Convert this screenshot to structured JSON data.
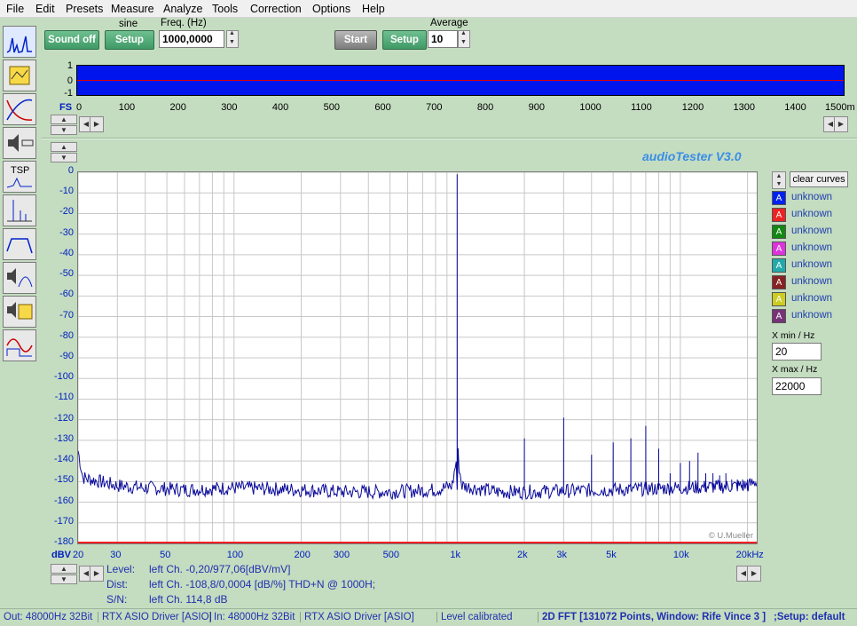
{
  "menu": [
    "File",
    "Edit",
    "Presets",
    "Measure",
    "Analyze",
    "Tools",
    "Correction",
    "Options",
    "Help"
  ],
  "generator": {
    "sound_button": "Sound off",
    "signal_type": "sine",
    "setup_button": "Setup",
    "freq_label": "Freq. (Hz)",
    "freq_value": "1000,0000"
  },
  "analyzer": {
    "start_button": "Start",
    "setup_button": "Setup",
    "average_label": "Average",
    "average_value": "10"
  },
  "scope": {
    "y_ticks": [
      "1",
      "0",
      "-1"
    ],
    "x_unit": "FS",
    "x_ticks": [
      "0",
      "100",
      "200",
      "300",
      "400",
      "500",
      "600",
      "700",
      "800",
      "900",
      "1000",
      "1100",
      "1200",
      "1300",
      "1400",
      "1500m"
    ]
  },
  "brand": "audioTester  V3.0",
  "clear_curves": "clear curves",
  "legend": [
    {
      "label": "unknown",
      "color": "#0022ee"
    },
    {
      "label": "unknown",
      "color": "#ee2222"
    },
    {
      "label": "unknown",
      "color": "#118811"
    },
    {
      "label": "unknown",
      "color": "#dd33dd"
    },
    {
      "label": "unknown",
      "color": "#22aaaa"
    },
    {
      "label": "unknown",
      "color": "#882222"
    },
    {
      "label": "unknown",
      "color": "#cccc22"
    },
    {
      "label": "unknown",
      "color": "#773377"
    }
  ],
  "x_min_label": "X min / Hz",
  "x_min_value": "20",
  "x_max_label": "X max / Hz",
  "x_max_value": "22000",
  "copyright": "© U.Mueller",
  "info": {
    "level_label": "Level:",
    "level_value": "left Ch. -0,20/977,06[dBV/mV]",
    "dist_label": "Dist:",
    "dist_value": "left Ch. -108,8/0,0004 [dB/%] THD+N  @ 1000H;",
    "sn_label": "S/N:",
    "sn_value": "left Ch. 114,8 dB"
  },
  "status": {
    "out": "Out: 48000Hz 32Bit",
    "driver_out": "RTX ASIO Driver [ASIO]",
    "in": "In: 48000Hz 32Bit",
    "driver_in": "RTX ASIO Driver [ASIO]",
    "level": "Level calibrated",
    "fft": "2D FFT [131072 Points, Window: Rife Vince 3 ]",
    "setup": ";Setup:  default"
  },
  "chart_data": {
    "type": "line",
    "xscale": "log",
    "xlim": [
      20,
      22000
    ],
    "ylim": [
      -180,
      0
    ],
    "ylabel": "dBV",
    "y_ticks": [
      "0",
      "-10",
      "-20",
      "-30",
      "-40",
      "-50",
      "-60",
      "-70",
      "-80",
      "-90",
      "-100",
      "-110",
      "-120",
      "-130",
      "-140",
      "-150",
      "-160",
      "-170",
      "-180"
    ],
    "x_ticks": [
      {
        "value": 20,
        "label": "20"
      },
      {
        "value": 30,
        "label": "30"
      },
      {
        "value": 50,
        "label": "50"
      },
      {
        "value": 100,
        "label": "100"
      },
      {
        "value": 200,
        "label": "200"
      },
      {
        "value": 300,
        "label": "300"
      },
      {
        "value": 500,
        "label": "500"
      },
      {
        "value": 1000,
        "label": "1k"
      },
      {
        "value": 2000,
        "label": "2k"
      },
      {
        "value": 3000,
        "label": "3k"
      },
      {
        "value": 5000,
        "label": "5k"
      },
      {
        "value": 10000,
        "label": "10k"
      },
      {
        "value": 20000,
        "label": "20kHz"
      }
    ],
    "series": [
      {
        "color": "#0a0a9a",
        "noise_floor_db": -154,
        "points": [
          [
            20,
            -135
          ],
          [
            21,
            -148
          ],
          [
            25,
            -150
          ],
          [
            30,
            -152
          ],
          [
            40,
            -153
          ],
          [
            60,
            -154
          ],
          [
            100,
            -153
          ],
          [
            200,
            -154
          ],
          [
            300,
            -155
          ],
          [
            500,
            -155
          ],
          [
            800,
            -154
          ],
          [
            950,
            -152
          ],
          [
            990,
            -140
          ],
          [
            1000,
            -1
          ],
          [
            1010,
            -140
          ],
          [
            1050,
            -152
          ],
          [
            1500,
            -155
          ],
          [
            2000,
            -155
          ],
          [
            5000,
            -154
          ],
          [
            10000,
            -153
          ],
          [
            20000,
            -152
          ],
          [
            22000,
            -150
          ]
        ],
        "peaks": [
          [
            1000,
            -1
          ],
          [
            2000,
            -129
          ],
          [
            3000,
            -119
          ],
          [
            4000,
            -137
          ],
          [
            5000,
            -131
          ],
          [
            6000,
            -129
          ],
          [
            7000,
            -123
          ],
          [
            8000,
            -134
          ],
          [
            9000,
            -146
          ],
          [
            10000,
            -141
          ],
          [
            11000,
            -140
          ],
          [
            12000,
            -136
          ],
          [
            13000,
            -146
          ],
          [
            14000,
            -146
          ],
          [
            15000,
            -147
          ],
          [
            16000,
            -146
          ],
          [
            17000,
            -149
          ],
          [
            18000,
            -149
          ],
          [
            19000,
            -149
          ],
          [
            20000,
            -149
          ]
        ]
      },
      {
        "color": "#ee2222",
        "points": [
          [
            20,
            -180
          ],
          [
            22000,
            -180
          ]
        ]
      }
    ]
  }
}
